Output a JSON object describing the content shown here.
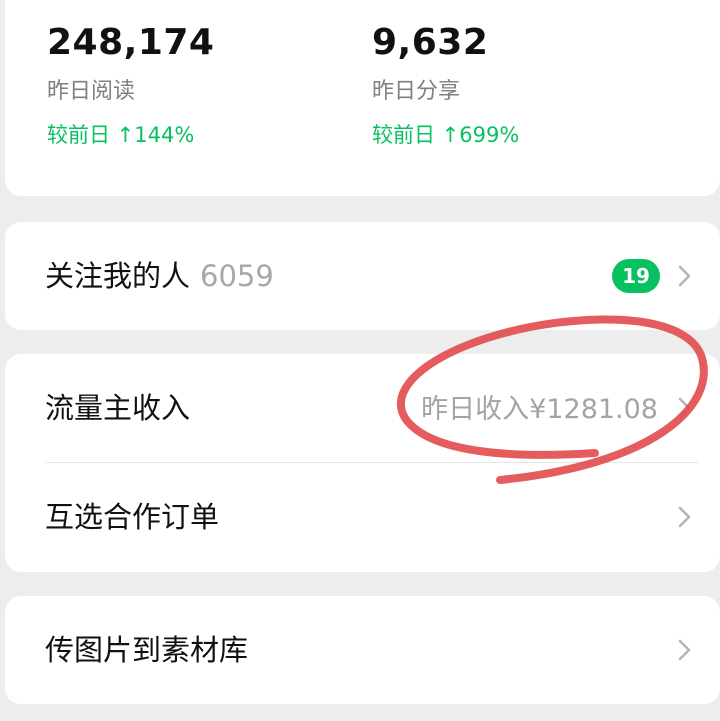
{
  "stats": {
    "reads": {
      "value": "248,174",
      "label": "昨日阅读",
      "change": "较前日 ↑144%"
    },
    "shares": {
      "value": "9,632",
      "label": "昨日分享",
      "change": "较前日 ↑699%"
    }
  },
  "followers_row": {
    "label": "关注我的人",
    "count": "6059",
    "badge": "19",
    "chevron_icon": "chevron-right-icon"
  },
  "revenue_row": {
    "label": "流量主收入",
    "value": "昨日收入¥1281.08",
    "chevron_icon": "chevron-right-icon"
  },
  "mutual_orders_row": {
    "label": "互选合作订单",
    "chevron_icon": "chevron-right-icon"
  },
  "upload_row": {
    "label": "传图片到素材库",
    "chevron_icon": "chevron-right-icon"
  },
  "colors": {
    "background": "#ededed",
    "card": "#ffffff",
    "accent_green": "#07c160",
    "muted_text": "#a8a8a8",
    "annotation_red": "#e24a4c"
  }
}
